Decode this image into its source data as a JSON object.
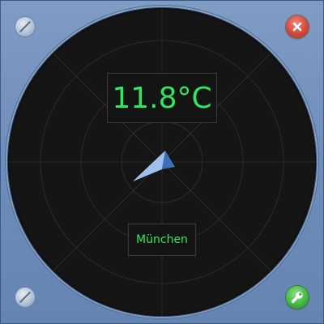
{
  "widget": {
    "temperature": "11.8°C",
    "city": "München",
    "wind_direction_icon": "wind-arrow-icon",
    "colors": {
      "display_text": "#2ee860",
      "dial_background": "#151515",
      "frame": "#7090bb",
      "close_button": "#d04a3a",
      "settings_button": "#43b843"
    }
  },
  "controls": {
    "close_icon": "close-icon",
    "settings_icon": "wrench-icon"
  }
}
